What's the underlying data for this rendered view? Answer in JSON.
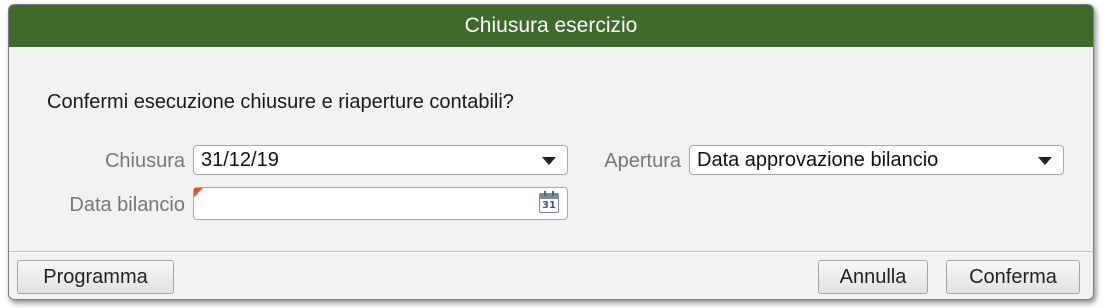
{
  "dialog": {
    "title": "Chiusura esercizio",
    "question": "Confermi esecuzione chiusure e riaperture contabili?"
  },
  "form": {
    "chiusura": {
      "label": "Chiusura",
      "value": "31/12/19",
      "icon": "chevron-down-icon"
    },
    "apertura": {
      "label": "Apertura",
      "value": "Data approvazione bilancio",
      "icon": "chevron-down-icon"
    },
    "data_bilancio": {
      "label": "Data bilancio",
      "value": "",
      "calendar_day": "31",
      "icon": "calendar-icon",
      "required_marker_color": "#e2562f"
    }
  },
  "buttons": {
    "programma": "Programma",
    "annulla": "Annulla",
    "conferma": "Conferma"
  },
  "colors": {
    "titlebar": "#3f6a2c",
    "dialog_bg": "#f2f2f2"
  }
}
